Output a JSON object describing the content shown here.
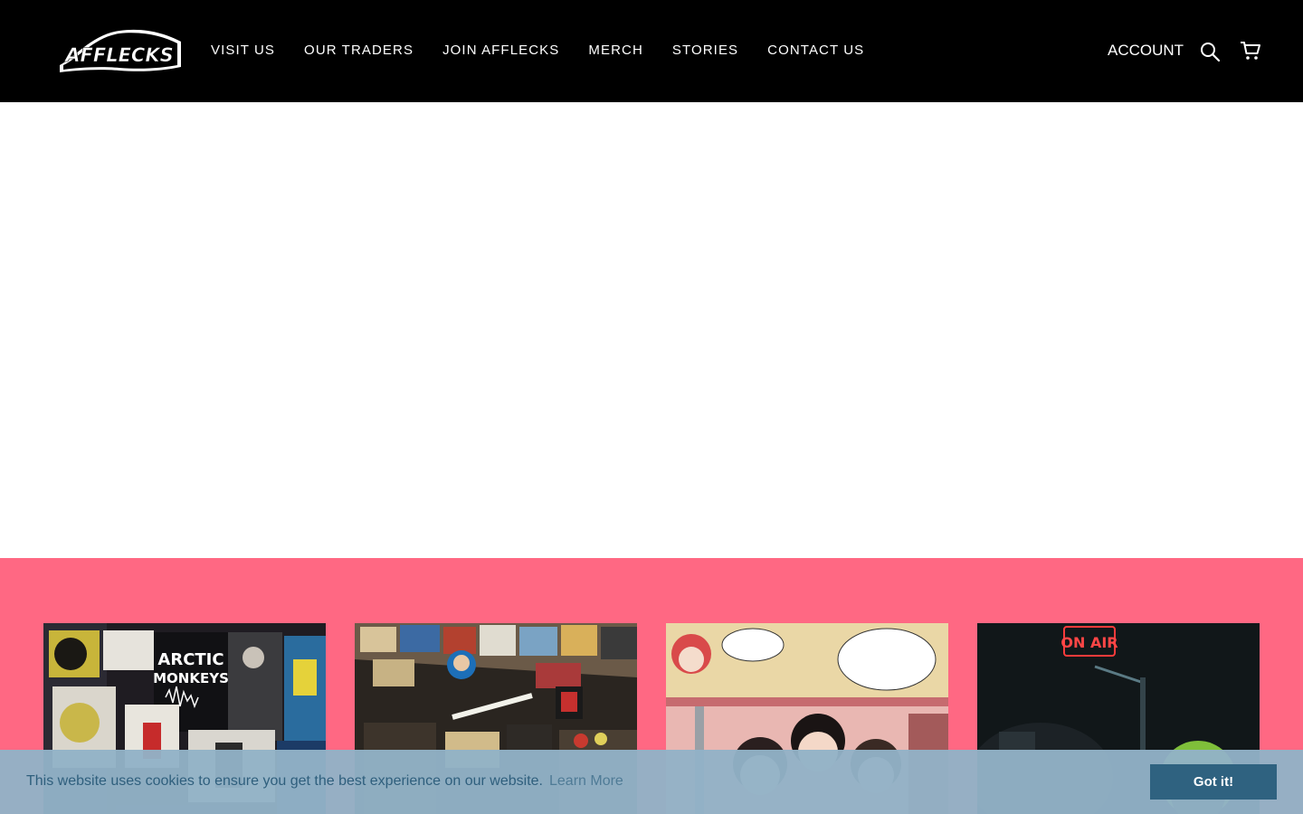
{
  "brand": {
    "logo_text": "AFFLECKS"
  },
  "nav": {
    "items": [
      {
        "label": "VISIT US"
      },
      {
        "label": "OUR TRADERS"
      },
      {
        "label": "JOIN AFFLECKS"
      },
      {
        "label": "MERCH"
      },
      {
        "label": "STORIES"
      },
      {
        "label": "CONTACT US"
      }
    ]
  },
  "header_actions": {
    "account_label": "ACCOUNT",
    "search_icon": "search-icon",
    "cart_icon": "cart-icon"
  },
  "cards": [
    {
      "image_text_1": "ARCTIC",
      "image_text_2": "MONKEYS"
    },
    {
      "image_text_1": ""
    },
    {
      "image_text_1": ""
    },
    {
      "image_text_1": "ON AIR"
    }
  ],
  "cookie": {
    "message": "This website uses cookies to ensure you get the best experience on our website.",
    "learn_more": "Learn More",
    "accept": "Got it!"
  },
  "colors": {
    "header_bg": "#000000",
    "pink_section": "#ff6883",
    "cookie_bg": "#92b2c7",
    "cookie_button": "#2f6280"
  }
}
